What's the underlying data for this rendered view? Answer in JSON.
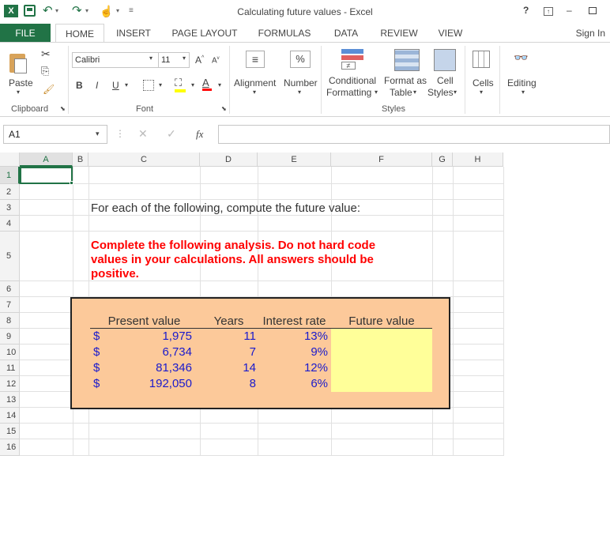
{
  "window": {
    "title": "Calculating future values - Excel",
    "help": "?",
    "restore": "⧉",
    "minimize": "–",
    "maximize": "🗗"
  },
  "tabs": [
    "FILE",
    "HOME",
    "INSERT",
    "PAGE LAYOUT",
    "FORMULAS",
    "DATA",
    "REVIEW",
    "VIEW"
  ],
  "signin": "Sign In",
  "ribbon": {
    "paste": "Paste",
    "font_name": "Calibri",
    "font_size": "11",
    "bold": "B",
    "italic": "I",
    "underline": "U",
    "alignment": "Alignment",
    "number": "Number",
    "conditional": "Conditional",
    "formatting": "Formatting",
    "format_as": "Format as",
    "table": "Table",
    "cell": "Cell",
    "styles_btn": "Styles",
    "cells": "Cells",
    "editing": "Editing",
    "groups": {
      "clipboard": "Clipboard",
      "font": "Font",
      "styles": "Styles"
    }
  },
  "formula_bar": {
    "name_box": "A1",
    "fx": "fx",
    "value": ""
  },
  "columns": [
    "A",
    "B",
    "C",
    "D",
    "E",
    "F",
    "G",
    "H"
  ],
  "rows": [
    "1",
    "2",
    "3",
    "4",
    "5",
    "6",
    "7",
    "8",
    "9",
    "10",
    "11",
    "12",
    "13",
    "14",
    "15",
    "16"
  ],
  "sheet": {
    "instruction": "For each of the following, compute the future value:",
    "warning_line1": "Complete the following analysis. Do not hard code",
    "warning_line2": "values in your calculations. All answers should be",
    "warning_line3": "positive.",
    "headers": {
      "pv": "Present value",
      "years": "Years",
      "rate": "Interest rate",
      "fv": "Future value"
    },
    "data": [
      {
        "dollar": "$",
        "pv": "1,975",
        "years": "11",
        "rate": "13%"
      },
      {
        "dollar": "$",
        "pv": "6,734",
        "years": "7",
        "rate": "9%"
      },
      {
        "dollar": "$",
        "pv": "81,346",
        "years": "14",
        "rate": "12%"
      },
      {
        "dollar": "$",
        "pv": "192,050",
        "years": "8",
        "rate": "6%"
      }
    ]
  },
  "colors": {
    "excel_green": "#217346",
    "panel_fill": "#fcc99a",
    "input_yellow": "#ffff99",
    "warning_red": "#ff0000",
    "value_blue": "#1a1acc"
  }
}
